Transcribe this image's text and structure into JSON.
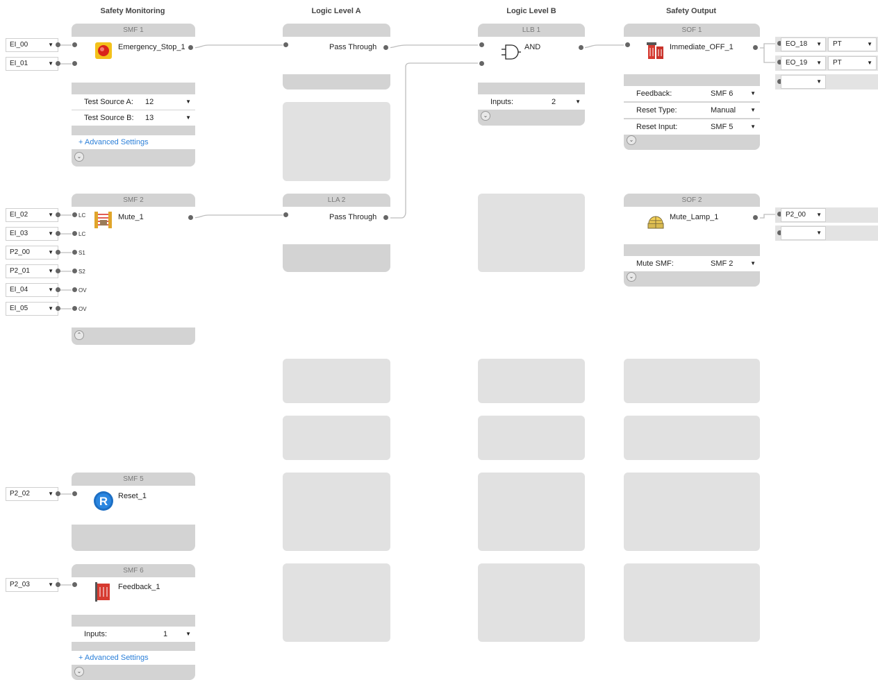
{
  "columns": {
    "smf": "Safety Monitoring",
    "lla": "Logic Level A",
    "llb": "Logic Level B",
    "sof": "Safety Output"
  },
  "smf1": {
    "title": "SMF 1",
    "name": "Emergency_Stop_1",
    "inputs": [
      "EI_00",
      "EI_01"
    ],
    "params": [
      {
        "label": "Test Source A:",
        "value": "12"
      },
      {
        "label": "Test Source B:",
        "value": "13"
      }
    ],
    "advanced": "+ Advanced Settings"
  },
  "smf2": {
    "title": "SMF 2",
    "name": "Mute_1",
    "inputs": [
      "EI_02",
      "EI_03",
      "P2_00",
      "P2_01",
      "EI_04",
      "EI_05"
    ],
    "pins": [
      "LC",
      "LC",
      "S1",
      "S2",
      "OV",
      "OV"
    ]
  },
  "smf5": {
    "title": "SMF 5",
    "name": "Reset_1",
    "inputs": [
      "P2_02"
    ]
  },
  "smf6": {
    "title": "SMF 6",
    "name": "Feedback_1",
    "inputs": [
      "P2_03"
    ],
    "params": [
      {
        "label": "Inputs:",
        "value": "1"
      }
    ],
    "advanced": "+ Advanced Settings"
  },
  "lla1": {
    "title": "",
    "name": "Pass Through"
  },
  "lla2": {
    "title": "LLA 2",
    "name": "Pass Through"
  },
  "llb1": {
    "title": "LLB 1",
    "name": "AND",
    "params": [
      {
        "label": "Inputs:",
        "value": "2"
      }
    ]
  },
  "sof1": {
    "title": "SOF 1",
    "name": "Immediate_OFF_1",
    "params": [
      {
        "label": "Feedback:",
        "value": "SMF 6"
      },
      {
        "label": "Reset Type:",
        "value": "Manual"
      },
      {
        "label": "Reset Input:",
        "value": "SMF 5"
      }
    ],
    "outputs": [
      {
        "name": "EO_18",
        "mode": "PT"
      },
      {
        "name": "EO_19",
        "mode": "PT"
      },
      {
        "name": "",
        "mode": ""
      }
    ]
  },
  "sof2": {
    "title": "SOF 2",
    "name": "Mute_Lamp_1",
    "params": [
      {
        "label": "Mute SMF:",
        "value": "SMF 2"
      }
    ],
    "outputs": [
      {
        "name": "P2_00"
      },
      {
        "name": ""
      }
    ]
  },
  "icons": {
    "estop": "emergency-stop-icon",
    "mute": "light-curtain-icon",
    "reset": "reset-icon",
    "feedback": "contactor-icon",
    "and": "and-gate-icon",
    "sof1": "contactor-output-icon",
    "lamp": "lamp-icon"
  }
}
